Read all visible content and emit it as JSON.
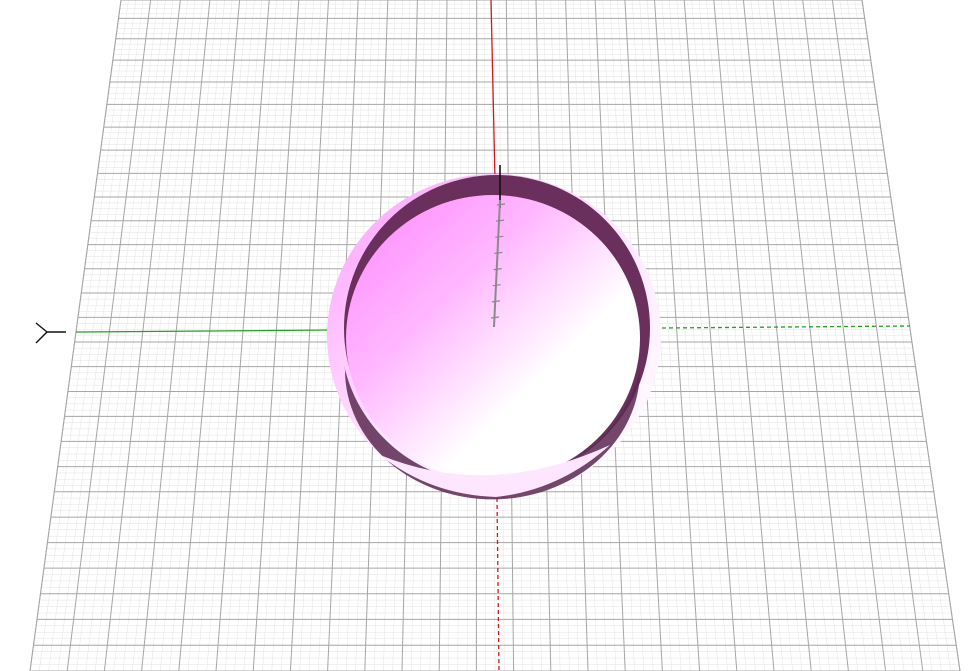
{
  "scene": {
    "background": "#ffffff",
    "colors": {
      "grid_minor": "#e3e3e3",
      "grid_major": "#a6a6a6",
      "axis_x": "#d11a1a",
      "axis_y": "#22a022",
      "axis_z": "#1a1a1a",
      "object_light": "#ffffff",
      "object_mid": "#ffb3ff",
      "object_dark": "#ff85ff",
      "rim_shadow": "#6a2f5c",
      "ruler": "#8a8a8a"
    },
    "icons": [
      "y-axis-indicator-icon"
    ],
    "objects": [
      "cylinder-cup"
    ]
  }
}
